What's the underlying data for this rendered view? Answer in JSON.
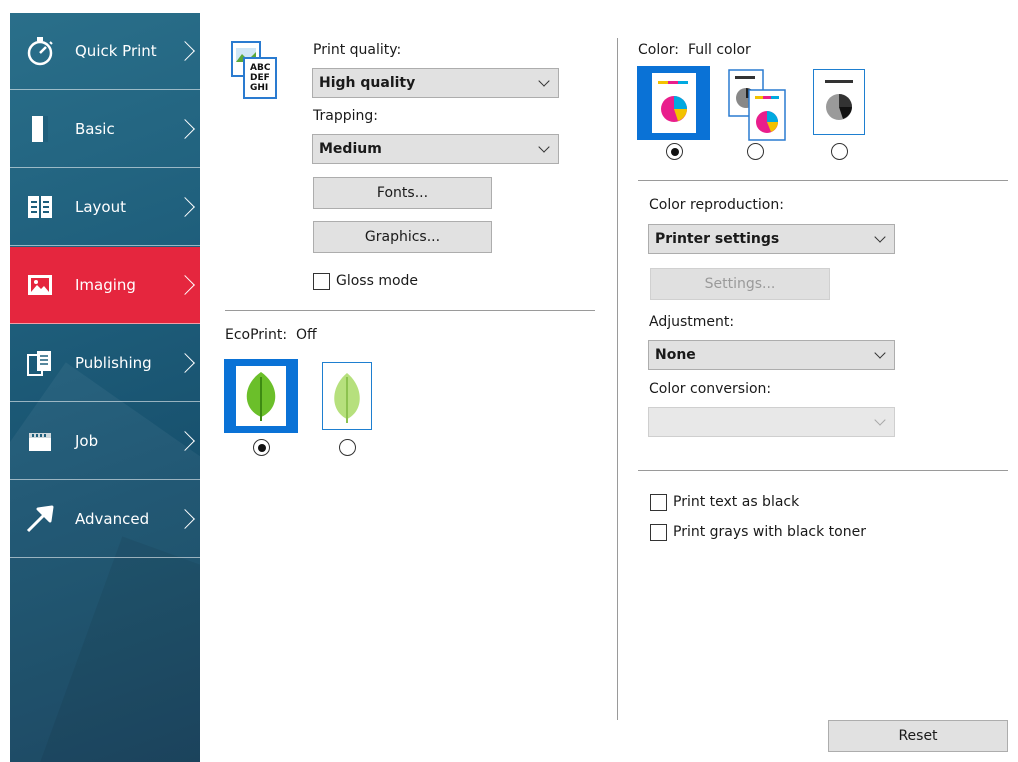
{
  "sidebar": {
    "items": [
      {
        "label": "Quick Print",
        "icon": "stopwatch-icon",
        "active": false
      },
      {
        "label": "Basic",
        "icon": "page-icon",
        "active": false
      },
      {
        "label": "Layout",
        "icon": "layout-icon",
        "active": false
      },
      {
        "label": "Imaging",
        "icon": "image-icon",
        "active": true
      },
      {
        "label": "Publishing",
        "icon": "publishing-icon",
        "active": false
      },
      {
        "label": "Job",
        "icon": "job-icon",
        "active": false
      },
      {
        "label": "Advanced",
        "icon": "arrow-icon",
        "active": false
      }
    ],
    "active_color": "#e5263e"
  },
  "quality": {
    "print_quality_label": "Print quality:",
    "print_quality_value": "High quality",
    "icon_text_lines": [
      "ABC",
      "DEF",
      "GHI"
    ],
    "trapping_label": "Trapping:",
    "trapping_value": "Medium",
    "fonts_button": "Fonts...",
    "graphics_button": "Graphics...",
    "gloss_mode_label": "Gloss mode",
    "gloss_mode_checked": false
  },
  "ecoprint": {
    "label": "EcoPrint:",
    "value": "Off",
    "options": [
      {
        "icon": "leaf-icon",
        "selected": true
      },
      {
        "icon": "leaf-light-icon",
        "selected": false
      }
    ]
  },
  "color": {
    "label": "Color:",
    "value": "Full color",
    "options": [
      {
        "icon": "full-color-icon",
        "selected": true
      },
      {
        "icon": "auto-color-icon",
        "selected": false
      },
      {
        "icon": "black-white-icon",
        "selected": false
      }
    ],
    "color_reproduction_label": "Color reproduction:",
    "color_reproduction_value": "Printer settings",
    "settings_button": "Settings...",
    "adjustment_label": "Adjustment:",
    "adjustment_value": "None",
    "color_conversion_label": "Color conversion:",
    "color_conversion_value": "",
    "print_text_black_label": "Print text as black",
    "print_text_black_checked": false,
    "print_grays_label": "Print grays with black toner",
    "print_grays_checked": false
  },
  "footer": {
    "reset_button": "Reset"
  }
}
